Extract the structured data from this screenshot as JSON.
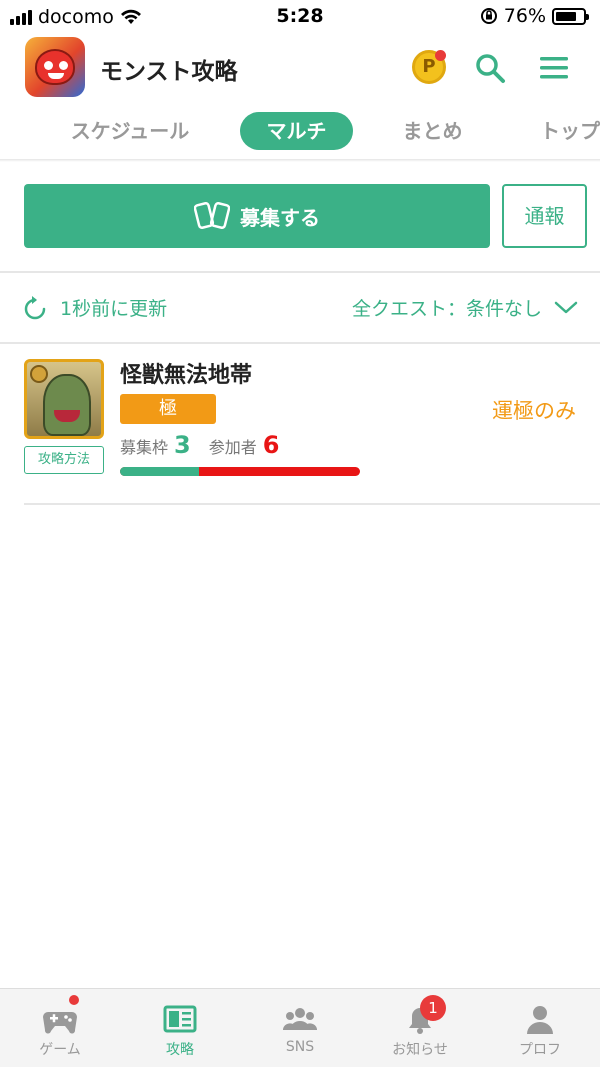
{
  "status_bar": {
    "carrier": "docomo",
    "time": "5:28",
    "battery_text": "76%",
    "battery_level": 0.76
  },
  "header": {
    "title": "モンスト攻略",
    "coin_label": "P",
    "icons": [
      "app-logo",
      "point-coin-icon",
      "search-icon",
      "menu-icon"
    ]
  },
  "tabs": [
    {
      "label": "スケジュール",
      "active": false
    },
    {
      "label": "マルチ",
      "active": true
    },
    {
      "label": "まとめ",
      "active": false
    },
    {
      "label": "トップ",
      "active": false
    }
  ],
  "actions": {
    "recruit_label": "募集する",
    "report_label": "通報"
  },
  "refresh": {
    "updated_text": "1秒前に更新",
    "filter_text": "全クエスト：条件なし"
  },
  "quests": [
    {
      "name": "怪獣無法地帯",
      "difficulty": "極",
      "condition": "運極のみ",
      "guide_label": "攻略方法",
      "slots_label": "募集枠",
      "slots": "3",
      "participants_label": "参加者",
      "participants": "6",
      "progress_ratio": 0.33
    }
  ],
  "bottom_nav": [
    {
      "label": "ゲーム",
      "icon": "gamepad-icon",
      "active": false,
      "dot": true
    },
    {
      "label": "攻略",
      "icon": "guide-book-icon",
      "active": true
    },
    {
      "label": "SNS",
      "icon": "people-icon",
      "active": false
    },
    {
      "label": "お知らせ",
      "icon": "bell-icon",
      "active": false,
      "badge": "1"
    },
    {
      "label": "プロフ",
      "icon": "profile-icon",
      "active": false
    }
  ],
  "colors": {
    "accent": "#3bb187",
    "orange": "#f29a16",
    "red": "#e81515"
  }
}
